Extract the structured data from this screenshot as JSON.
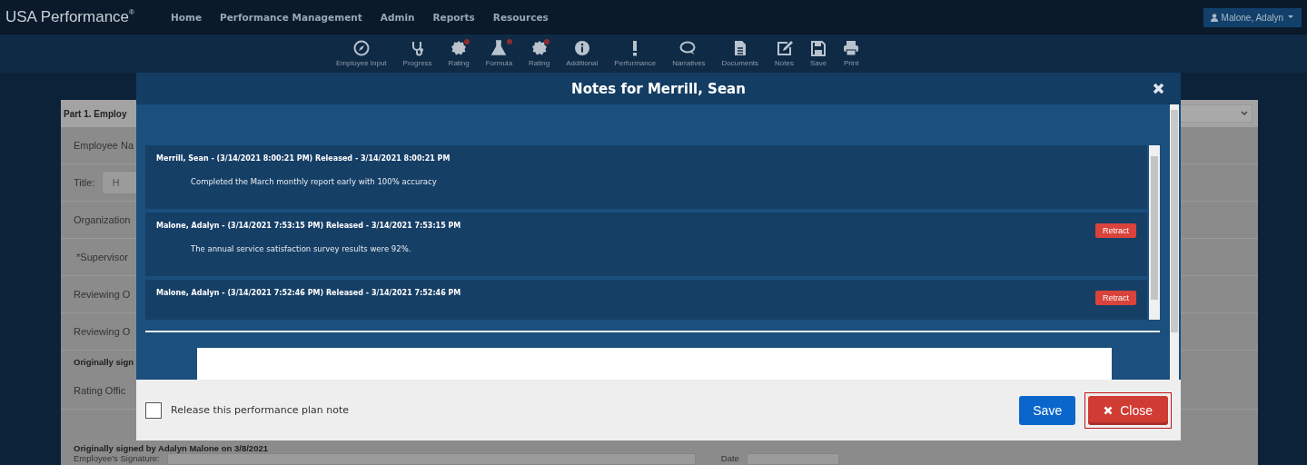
{
  "navbar": {
    "brand": "USA Performance",
    "brand_mark": "®",
    "menu": [
      "Home",
      "Performance Management",
      "Admin",
      "Reports",
      "Resources"
    ],
    "user": "Malone, Adalyn"
  },
  "toolbar": [
    {
      "label": "Employee Input",
      "flagged": false
    },
    {
      "label": "Progress",
      "flagged": false
    },
    {
      "label": "Rating",
      "flagged": true
    },
    {
      "label": "Formula",
      "flagged": true
    },
    {
      "label": "Rating",
      "flagged": true
    },
    {
      "label": "Additional",
      "flagged": false
    },
    {
      "label": "Performance",
      "flagged": false
    },
    {
      "label": "Narratives",
      "flagged": false
    },
    {
      "label": "Documents",
      "flagged": false
    },
    {
      "label": "Notes",
      "flagged": false
    },
    {
      "label": "Save",
      "flagged": false
    },
    {
      "label": "Print",
      "flagged": false
    }
  ],
  "form": {
    "section_title": "Part 1. Employ",
    "rows": [
      {
        "kind": "label",
        "label": "Employee Na"
      },
      {
        "kind": "input",
        "label": "Title:",
        "value": "H"
      },
      {
        "kind": "label",
        "label": "Organization"
      },
      {
        "kind": "label",
        "label": " *Supervisor"
      },
      {
        "kind": "label",
        "label": "Reviewing O"
      },
      {
        "kind": "label",
        "label": "Reviewing O"
      },
      {
        "kind": "note",
        "label": "Originally sign"
      },
      {
        "kind": "label",
        "label": "Rating Offic"
      },
      {
        "kind": "note",
        "label": "Originally signed by Adalyn Malone on 3/8/2021"
      },
      {
        "kind": "signature",
        "label": "Employee's Signature:",
        "date_label": "Date"
      }
    ]
  },
  "modal": {
    "title": "Notes for Merrill, Sean",
    "notes": [
      {
        "header": "Merrill, Sean - (3/14/2021 8:00:21 PM) Released - 3/14/2021 8:00:21 PM",
        "body": "Completed the March monthly report early with 100% accuracy",
        "retractable": false
      },
      {
        "header": "Malone, Adalyn - (3/14/2021 7:53:15 PM) Released - 3/14/2021 7:53:15 PM",
        "body": "The annual service satisfaction survey results were 92%.",
        "retractable": true,
        "action": "Retract"
      },
      {
        "header": "Malone, Adalyn - (3/14/2021 7:52:46 PM) Released - 3/14/2021 7:52:46 PM",
        "retractable": true,
        "action": "Retract"
      }
    ],
    "release": {
      "label": "Release this performance plan note",
      "checked": false
    },
    "buttons": [
      {
        "label": "Save",
        "kind": "primary",
        "focused": false
      },
      {
        "label": "Close",
        "kind": "danger",
        "focused": true
      }
    ]
  }
}
